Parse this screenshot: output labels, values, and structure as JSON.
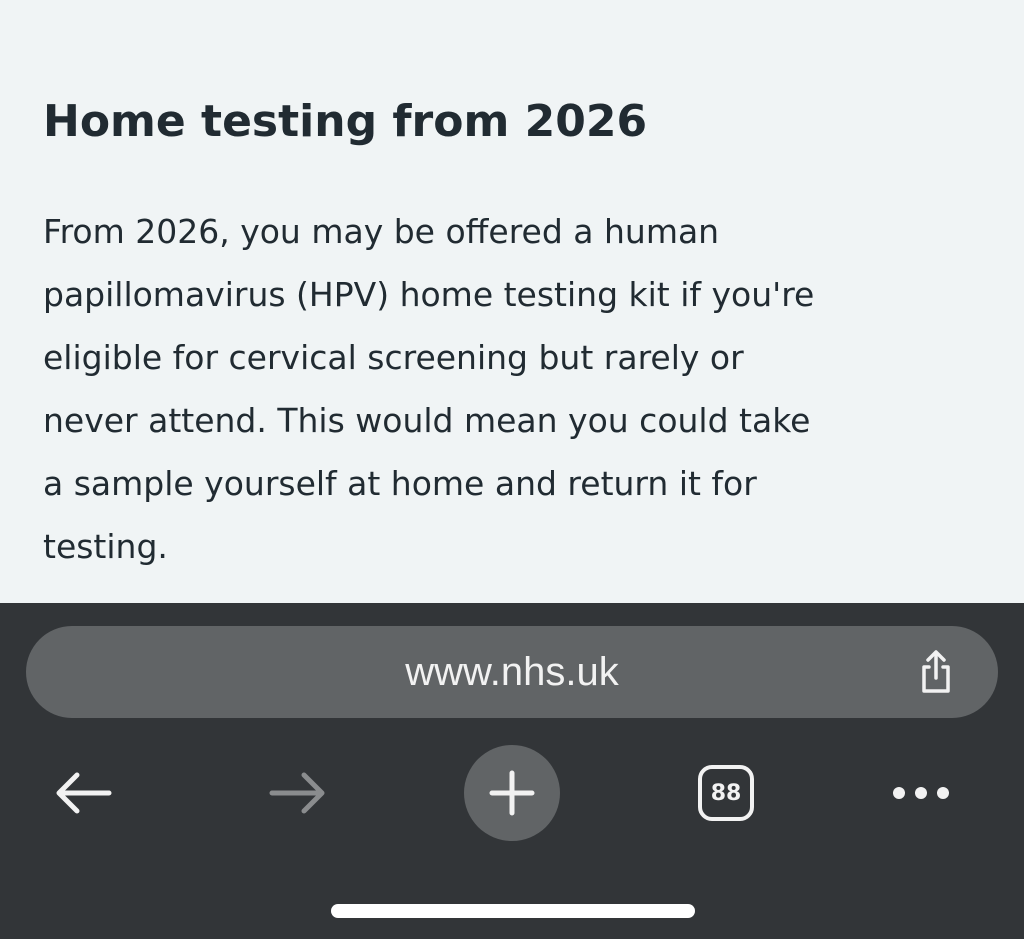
{
  "article": {
    "heading": "Home testing from 2026",
    "paragraph_lines": [
      "From 2026, you may be offered a human",
      "papillomavirus (HPV) home testing kit if you're",
      "eligible for cervical screening but rarely or",
      "never attend. This would mean you could take",
      "a sample yourself at home and return it for",
      "testing."
    ]
  },
  "browser": {
    "address_bar": {
      "url": "www.nhs.uk",
      "share_icon": "share-icon"
    },
    "toolbar": {
      "back_icon": "arrow-left-icon",
      "forward_icon": "arrow-right-icon",
      "new_tab_icon": "plus-icon",
      "tab_count": "88",
      "more_icon": "ellipsis-icon"
    }
  },
  "colors": {
    "page_background": "#f0f4f5",
    "text": "#212b32",
    "browser_bar": "#323538",
    "url_pill": "#616466",
    "icon_active": "#f2f2f2",
    "icon_disabled": "#8a8c8e"
  }
}
